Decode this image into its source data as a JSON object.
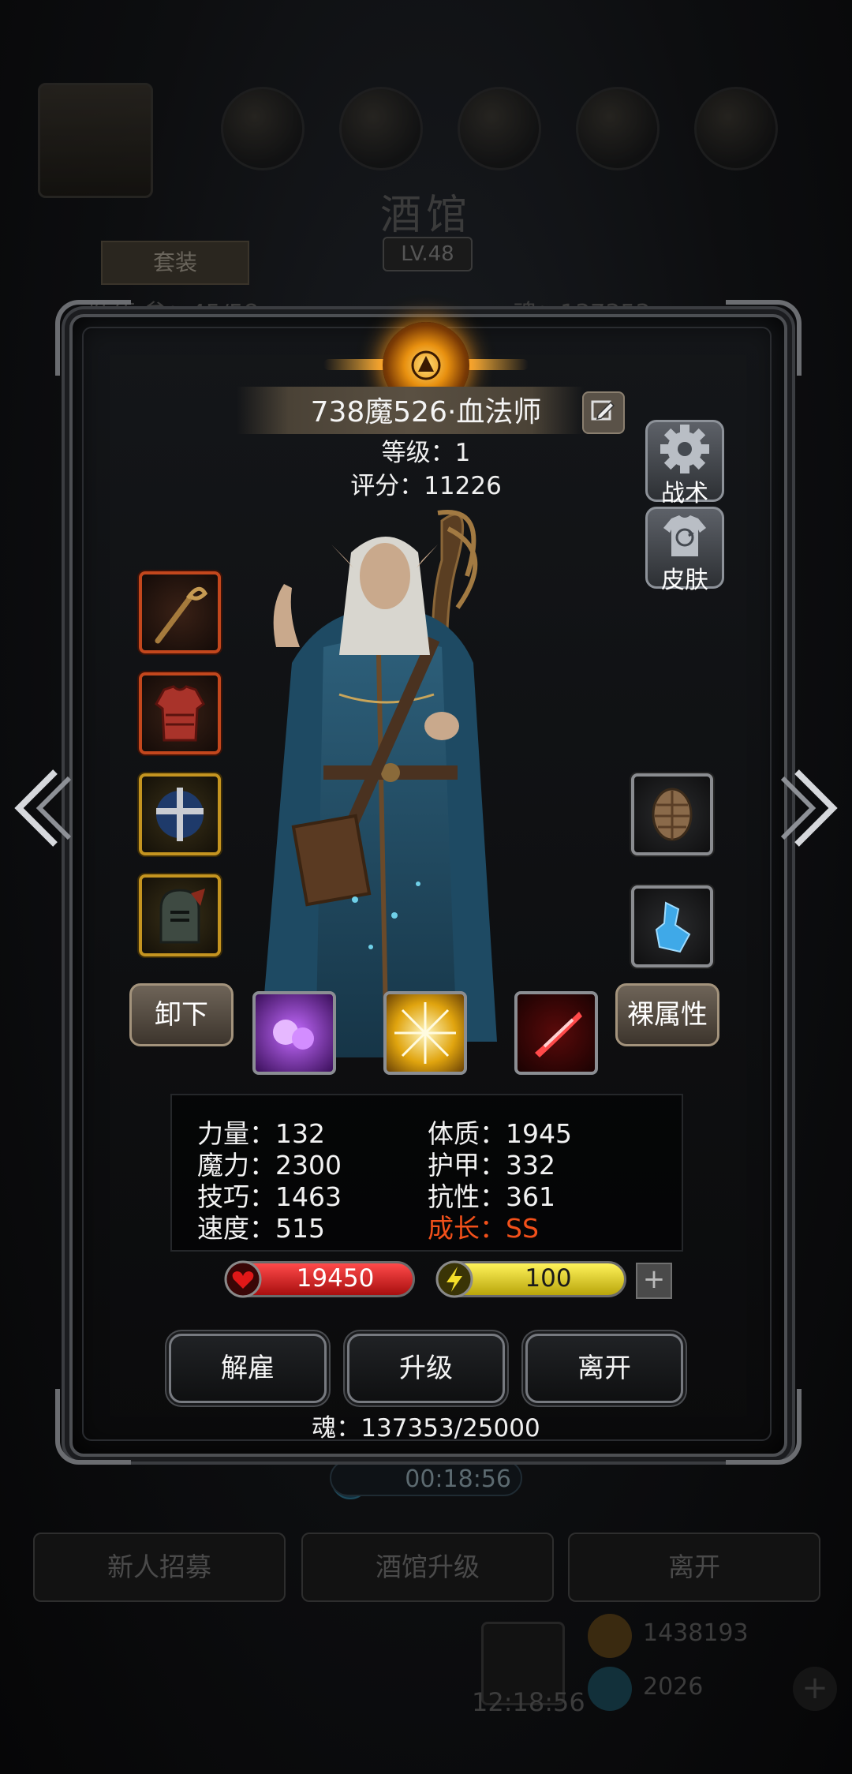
{
  "background": {
    "title": "酒馆",
    "level": "LV.48",
    "suit_tab": "套装",
    "team_count": "队伍·参：45/58",
    "soul_top": "魂：137353",
    "timer": "00:18:56",
    "buttons": [
      "新人招募",
      "酒馆升级",
      "离开"
    ],
    "gift_timer": "12:18:56",
    "gold": "1438193",
    "gems": "2026"
  },
  "hero": {
    "name": "738魔526·血法师",
    "level_text": "等级：1",
    "score_text": "评分：11226"
  },
  "side_buttons": {
    "tactics": "战术",
    "skin": "皮肤"
  },
  "equipment": {
    "left": [
      "staff-icon",
      "armor-icon",
      "cross-helm-icon",
      "helmet-icon"
    ],
    "right": [
      "shell-shield-icon",
      "crystal-icon"
    ]
  },
  "actions": {
    "unequip": "卸下",
    "bare_attributes": "裸属性"
  },
  "skills": [
    "purple-orb-icon",
    "golden-burst-icon",
    "red-slash-icon"
  ],
  "stats": {
    "strength": "力量：132",
    "magic": "魔力：2300",
    "skill": "技巧：1463",
    "speed": "速度：515",
    "constitution": "体质：1945",
    "armor": "护甲：332",
    "resistance": "抗性：361",
    "growth": "成长：SS"
  },
  "bars": {
    "hp": "19450",
    "energy": "100",
    "plus": "+"
  },
  "buttons": {
    "dismiss": "解雇",
    "upgrade": "升级",
    "leave": "离开"
  },
  "soul": "魂：137353/25000",
  "colors": {
    "growth": "#f2501a",
    "hp": "#d11a1a",
    "energy": "#e4d21c",
    "slot_red": "#c3471d",
    "slot_yellow": "#c49420"
  }
}
